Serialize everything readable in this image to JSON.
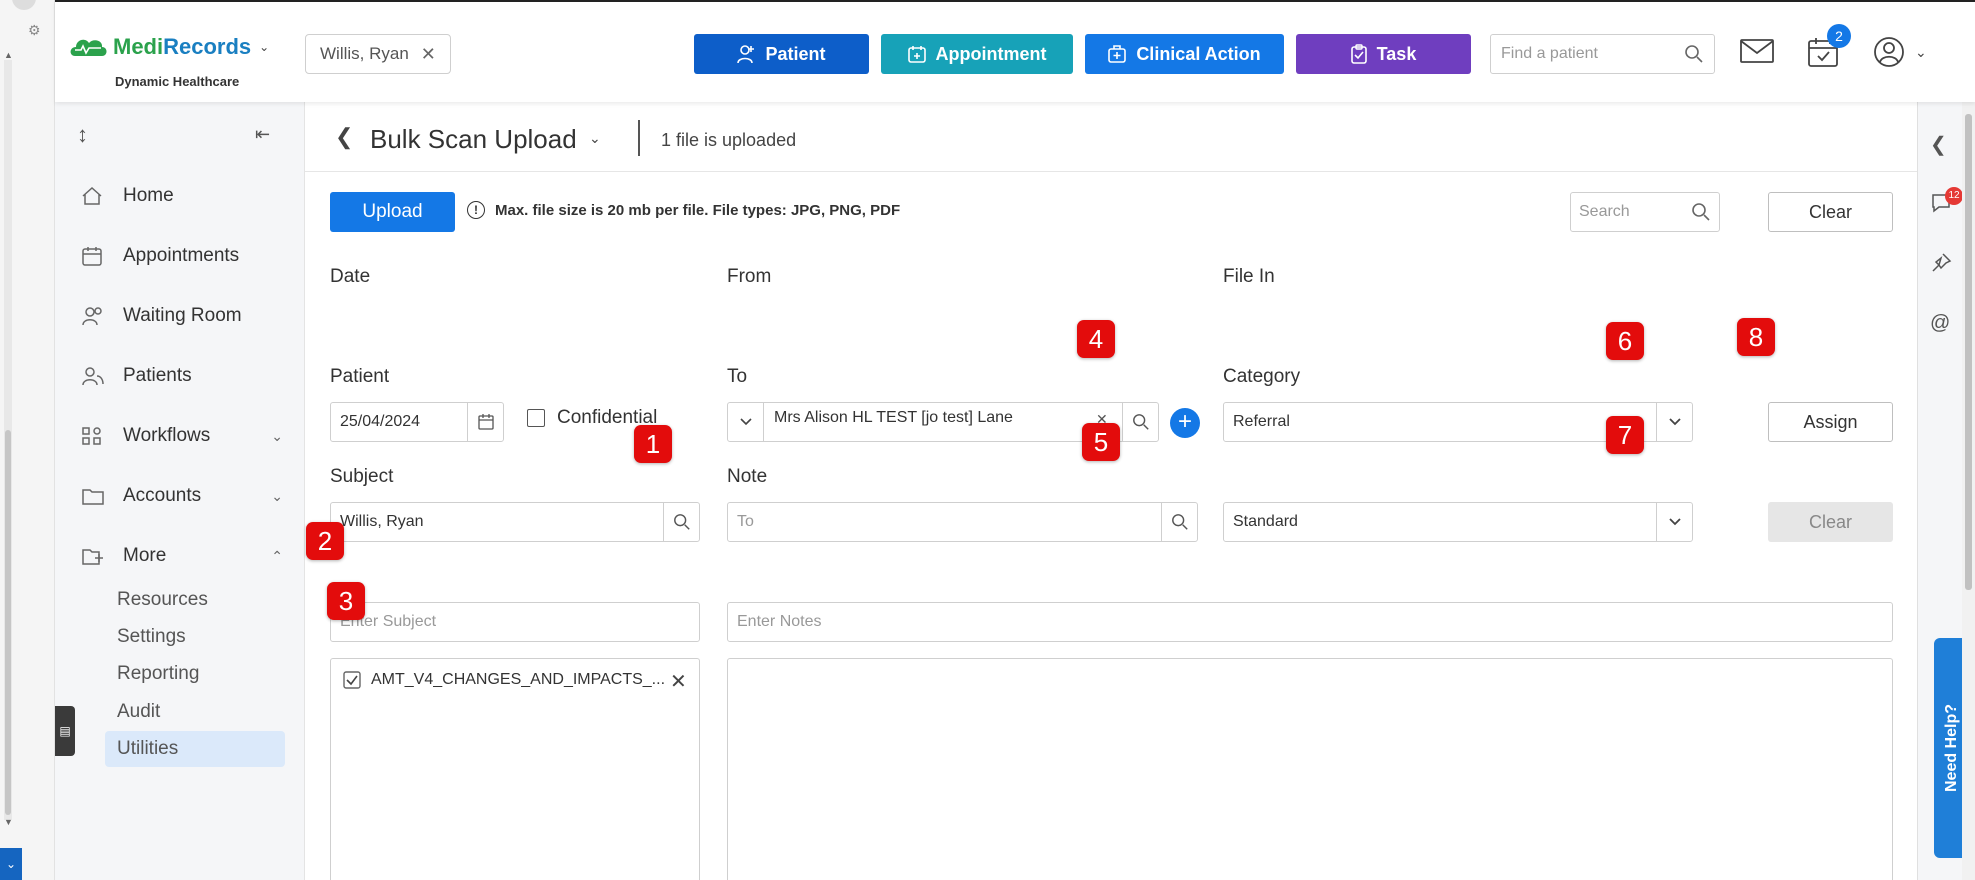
{
  "app": {
    "brand_medi": "Medi",
    "brand_records": "Records",
    "brand_sub": "Dynamic Healthcare"
  },
  "header": {
    "patient_chip": "Willis, Ryan",
    "buttons": {
      "patient": "Patient",
      "appointment": "Appointment",
      "clinical_action": "Clinical Action",
      "task": "Task"
    },
    "search_placeholder": "Find a patient",
    "calendar_badge": "2"
  },
  "sidebar": {
    "items": [
      {
        "label": "Home",
        "icon": "home-icon"
      },
      {
        "label": "Appointments",
        "icon": "calendar-icon"
      },
      {
        "label": "Waiting Room",
        "icon": "people-icon"
      },
      {
        "label": "Patients",
        "icon": "patients-icon"
      },
      {
        "label": "Workflows",
        "icon": "workflow-icon"
      },
      {
        "label": "Accounts",
        "icon": "folder-icon"
      },
      {
        "label": "More",
        "icon": "folder-tree-icon"
      }
    ],
    "sub_items": [
      "Resources",
      "Settings",
      "Reporting",
      "Audit",
      "Utilities"
    ],
    "active_sub": "Utilities"
  },
  "rail": {
    "chat_badge": "12",
    "need_help": "Need Help?"
  },
  "page": {
    "title": "Bulk Scan Upload",
    "status": "1 file is uploaded",
    "upload_label": "Upload",
    "info_text": "Max. file size is 20 mb per file. File types: JPG, PNG, PDF",
    "search_placeholder": "Search",
    "clear_top_label": "Clear"
  },
  "form": {
    "date_label": "Date",
    "date_value": "25/04/2024",
    "confidential_label": "Confidential",
    "from_label": "From",
    "from_value": "Mrs Alison HL TEST [jo test] Lane",
    "file_in_label": "File In",
    "file_in_value": "Referral",
    "assign_label": "Assign",
    "patient_label": "Patient",
    "patient_value": "Willis, Ryan",
    "to_label": "To",
    "to_placeholder": "To",
    "category_label": "Category",
    "category_value": "Standard",
    "clear_label": "Clear",
    "subject_label": "Subject",
    "subject_placeholder": "Enter Subject",
    "note_label": "Note",
    "note_placeholder": "Enter Notes"
  },
  "files": [
    {
      "name": "AMT_V4_CHANGES_AND_IMPACTS_...",
      "checked": true
    }
  ],
  "markers": [
    "1",
    "2",
    "3",
    "4",
    "5",
    "6",
    "7",
    "8"
  ],
  "colors": {
    "primary": "#1478e6",
    "patient_btn": "#0d5ec9",
    "appointment_btn": "#17a2b8",
    "task_btn": "#6f3ebf",
    "marker": "#e30c0c"
  }
}
